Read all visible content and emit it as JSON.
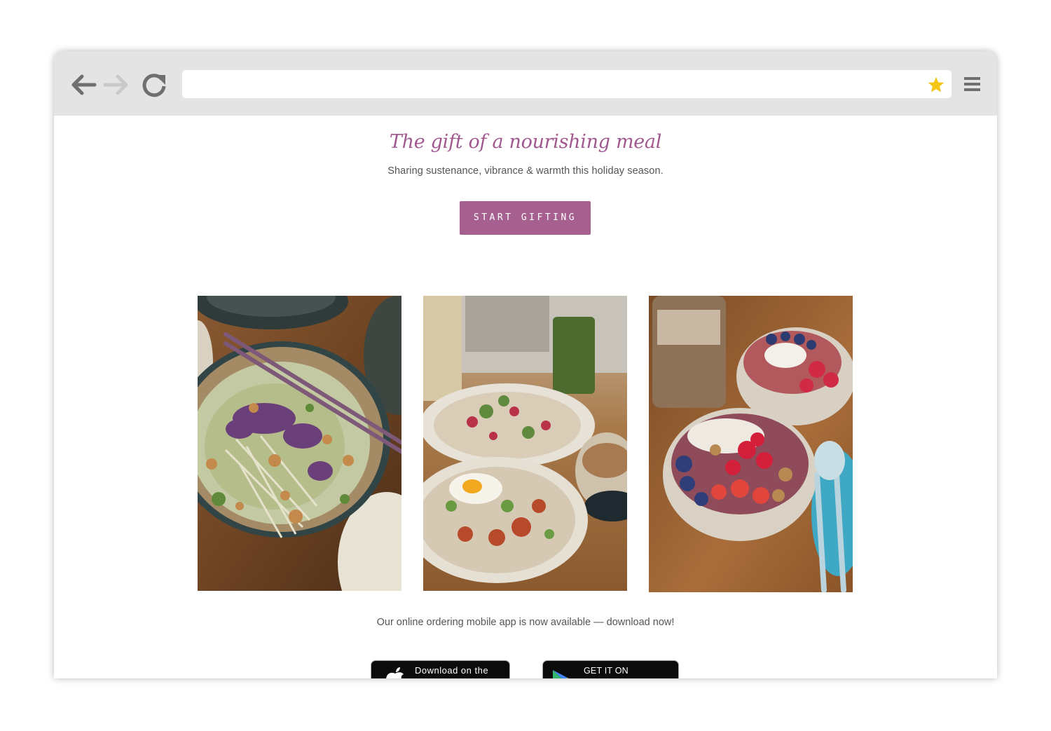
{
  "browser": {
    "address_value": "",
    "icons": [
      "back-arrow-icon",
      "forward-arrow-icon",
      "reload-icon",
      "bookmark-star-icon",
      "hamburger-menu-icon"
    ],
    "star_color": "#f5c518"
  },
  "hero": {
    "title": "The gift of a nourishing meal",
    "subtitle": "Sharing sustenance, vibrance & warmth this holiday season.",
    "cta_label": "START GIFTING",
    "accent_color": "#a6608f"
  },
  "gallery": {
    "photos": [
      "noodle-bowl-with-chopsticks-photo",
      "egg-salad-plates-photo",
      "acai-fruit-bowls-photo"
    ]
  },
  "app_promo": {
    "text": "Our online ordering mobile app is now available — download now!",
    "apple_badge": "Download on the",
    "google_badge": "GET IT ON"
  }
}
